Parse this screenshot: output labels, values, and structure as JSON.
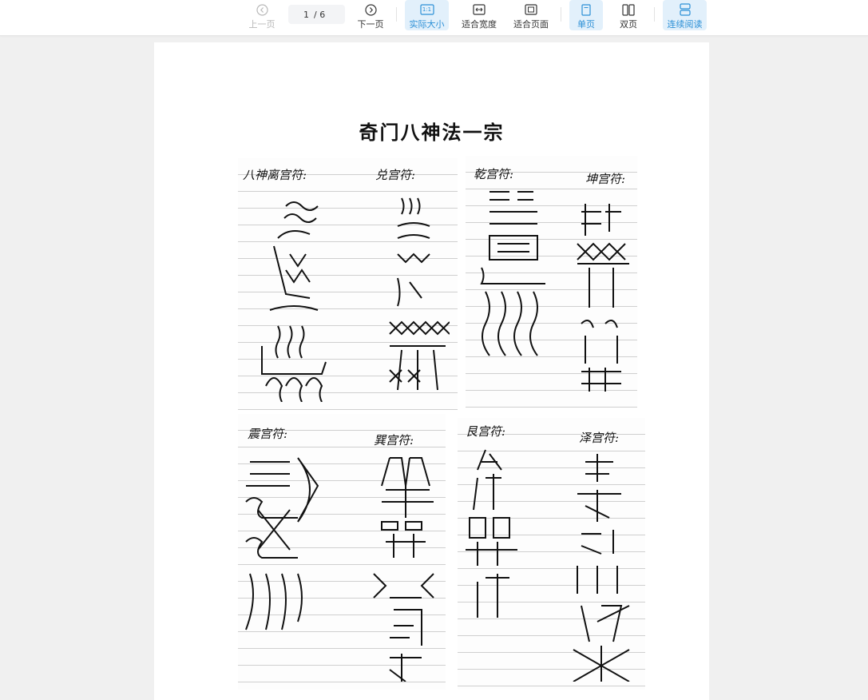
{
  "toolbar": {
    "prev_label": "上一页",
    "next_label": "下一页",
    "current_page": "1",
    "total_pages": "/ 6",
    "actual_size_label": "实际大小",
    "actual_size_icon_text": "1:1",
    "fit_width_label": "适合宽度",
    "fit_page_label": "适合页面",
    "single_page_label": "单页",
    "double_page_label": "双页",
    "continuous_label": "连续阅读"
  },
  "document": {
    "title": "奇门八神法一宗",
    "sheets": [
      {
        "labels": [
          "八神离宫符:",
          "兑宫符:"
        ]
      },
      {
        "labels": [
          "乾宫符:",
          "坤宫符:"
        ]
      },
      {
        "labels": [
          "震宫符:",
          "巽宫符:"
        ]
      },
      {
        "labels": [
          "艮宫符:",
          "泽宫符:"
        ]
      }
    ]
  },
  "colors": {
    "accent": "#2b8fd6",
    "active_bg": "#e2f0fb"
  }
}
